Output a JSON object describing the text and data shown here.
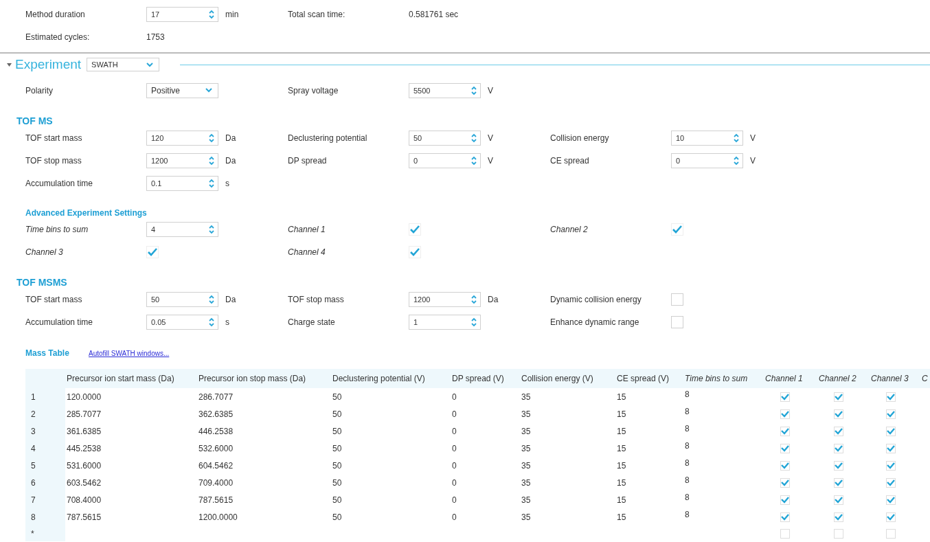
{
  "top": {
    "rows": [
      [
        {
          "kind": "spin",
          "label": "Method duration",
          "value": "17",
          "unit": "min"
        },
        {
          "kind": "text",
          "label": "Total scan time:",
          "value": "0.581761 sec"
        }
      ],
      [
        {
          "kind": "text",
          "label": "Estimated cycles:",
          "value": "1753"
        }
      ]
    ]
  },
  "experiment": {
    "title": "Experiment",
    "expanded": true,
    "type": "SWATH"
  },
  "sections": [
    {
      "rows": [
        [
          {
            "kind": "dropdown",
            "label": "Polarity",
            "value": "Positive"
          },
          {
            "kind": "spin",
            "label": "Spray voltage",
            "value": "5500",
            "unit": "V"
          }
        ]
      ]
    },
    {
      "heading": "TOF MS",
      "kind": "major",
      "rows": [
        [
          {
            "kind": "spin",
            "label": "TOF start mass",
            "value": "120",
            "unit": "Da"
          },
          {
            "kind": "spin",
            "label": "Declustering potential",
            "value": "50",
            "unit": "V"
          },
          {
            "kind": "spin",
            "label": "Collision energy",
            "value": "10",
            "unit": "V"
          }
        ],
        [
          {
            "kind": "spin",
            "label": "TOF stop mass",
            "value": "1200",
            "unit": "Da"
          },
          {
            "kind": "spin",
            "label": "DP spread",
            "value": "0",
            "unit": "V"
          },
          {
            "kind": "spin",
            "label": "CE spread",
            "value": "0",
            "unit": "V"
          }
        ],
        [
          {
            "kind": "spin",
            "label": "Accumulation time",
            "value": "0.1",
            "unit": "s"
          }
        ]
      ]
    },
    {
      "heading": "Advanced Experiment Settings",
      "kind": "minor",
      "italic": true,
      "rows": [
        [
          {
            "kind": "spin",
            "label": "Time bins to sum",
            "value": "4"
          },
          {
            "kind": "check",
            "label": "Channel 1",
            "checked": true
          },
          {
            "kind": "check",
            "label": "Channel 2",
            "checked": true
          }
        ],
        [
          {
            "kind": "check",
            "label": "Channel 3",
            "checked": true
          },
          {
            "kind": "check",
            "label": "Channel 4",
            "checked": true
          }
        ]
      ]
    },
    {
      "heading": "TOF MSMS",
      "kind": "major",
      "rows": [
        [
          {
            "kind": "spin",
            "label": "TOF start mass",
            "value": "50",
            "unit": "Da"
          },
          {
            "kind": "spin",
            "label": "TOF stop mass",
            "value": "1200",
            "unit": "Da"
          },
          {
            "kind": "check",
            "label": "Dynamic collision energy",
            "checked": false
          }
        ],
        [
          {
            "kind": "spin",
            "label": "Accumulation time",
            "value": "0.05",
            "unit": "s"
          },
          {
            "kind": "spin",
            "label": "Charge state",
            "value": "1"
          },
          {
            "kind": "check",
            "label": "Enhance dynamic range",
            "checked": false
          }
        ]
      ]
    }
  ],
  "mass_table": {
    "title": "Mass Table",
    "link": "Autofill SWATH windows...",
    "columns": [
      {
        "label": "Precursor ion start mass (Da)",
        "italic": false
      },
      {
        "label": "Precursor ion stop mass (Da)",
        "italic": false
      },
      {
        "label": "Declustering potential (V)",
        "italic": false
      },
      {
        "label": "DP spread (V)",
        "italic": false
      },
      {
        "label": "Collision energy (V)",
        "italic": false
      },
      {
        "label": "CE spread (V)",
        "italic": false
      },
      {
        "label": "Time bins to sum",
        "italic": true
      },
      {
        "label": "Channel 1",
        "italic": true
      },
      {
        "label": "Channel 2",
        "italic": true
      },
      {
        "label": "Channel 3",
        "italic": true
      },
      {
        "label": "C",
        "italic": true
      }
    ],
    "rows": [
      {
        "num": "1",
        "values": [
          "120.0000",
          "286.7077",
          "50",
          "0",
          "35",
          "15",
          "8"
        ],
        "channels": [
          true,
          true,
          true
        ]
      },
      {
        "num": "2",
        "values": [
          "285.7077",
          "362.6385",
          "50",
          "0",
          "35",
          "15",
          "8"
        ],
        "channels": [
          true,
          true,
          true
        ]
      },
      {
        "num": "3",
        "values": [
          "361.6385",
          "446.2538",
          "50",
          "0",
          "35",
          "15",
          "8"
        ],
        "channels": [
          true,
          true,
          true
        ]
      },
      {
        "num": "4",
        "values": [
          "445.2538",
          "532.6000",
          "50",
          "0",
          "35",
          "15",
          "8"
        ],
        "channels": [
          true,
          true,
          true
        ]
      },
      {
        "num": "5",
        "values": [
          "531.6000",
          "604.5462",
          "50",
          "0",
          "35",
          "15",
          "8"
        ],
        "channels": [
          true,
          true,
          true
        ]
      },
      {
        "num": "6",
        "values": [
          "603.5462",
          "709.4000",
          "50",
          "0",
          "35",
          "15",
          "8"
        ],
        "channels": [
          true,
          true,
          true
        ]
      },
      {
        "num": "7",
        "values": [
          "708.4000",
          "787.5615",
          "50",
          "0",
          "35",
          "15",
          "8"
        ],
        "channels": [
          true,
          true,
          true
        ]
      },
      {
        "num": "8",
        "values": [
          "787.5615",
          "1200.0000",
          "50",
          "0",
          "35",
          "15",
          "8"
        ],
        "channels": [
          true,
          true,
          true
        ]
      },
      {
        "num": "*",
        "channels": [
          false,
          false,
          false
        ]
      }
    ]
  }
}
